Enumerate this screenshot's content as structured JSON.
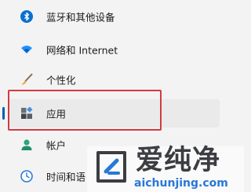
{
  "nav": {
    "items": [
      {
        "label": "蓝牙和其他设备",
        "icon": "bluetooth-icon"
      },
      {
        "label": "网络和 Internet",
        "icon": "wifi-icon"
      },
      {
        "label": "个性化",
        "icon": "brush-icon"
      },
      {
        "label": "应用",
        "icon": "apps-icon",
        "selected": true
      },
      {
        "label": "帐户",
        "icon": "account-icon"
      },
      {
        "label": "时间和语",
        "icon": "clock-icon"
      }
    ]
  },
  "watermark": {
    "title": "爱纯净",
    "url": "aichunjing.com"
  },
  "colors": {
    "accent": "#005fb8",
    "highlight_border": "#d23b3e",
    "watermark_url": "#2878d7"
  }
}
